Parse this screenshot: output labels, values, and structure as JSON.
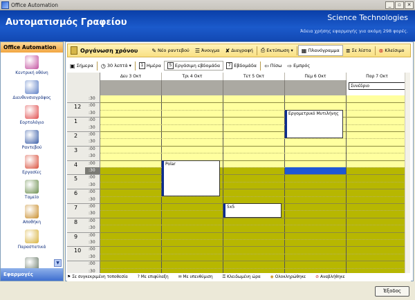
{
  "window": {
    "title": "Office Automation"
  },
  "header": {
    "app_title": "Αυτοματισμός Γραφείου",
    "company": "Science Technologies",
    "license": "Άδεια χρήσης εφαρμογής για ακόμη 298 φορές."
  },
  "sidebar": {
    "title": "Office Automation",
    "items": [
      {
        "label": "Κεντρική οθόνη",
        "icon": "home-people-icon",
        "color": "#c24f9e"
      },
      {
        "label": "Διευθυνσιογράφος",
        "icon": "contacts-icon",
        "color": "#5c7fc6"
      },
      {
        "label": "Εορτολόγιο",
        "icon": "calendar-icon",
        "color": "#e04c4c"
      },
      {
        "label": "Ραντεβού",
        "icon": "appointment-icon",
        "color": "#3a5ea8"
      },
      {
        "label": "Εργασίες",
        "icon": "tasks-icon",
        "color": "#d94e3a"
      },
      {
        "label": "Ταμείο",
        "icon": "cashbox-icon",
        "color": "#6b8e4e"
      },
      {
        "label": "Αποθήκη",
        "icon": "warehouse-icon",
        "color": "#c98d2a"
      },
      {
        "label": "Παραστατικά",
        "icon": "documents-icon",
        "color": "#d8b23b"
      },
      {
        "label": "",
        "icon": "recycle-bin-icon",
        "color": "#6a7b6a"
      }
    ],
    "footer": "Εφαρμογές"
  },
  "toolbar": {
    "section_title": "Οργάνωση χρόνου",
    "new_appointment": "Νέο ραντεβού",
    "open": "Άνοιγμα",
    "delete": "Διαγραφή",
    "print": "Εκτύπωση",
    "planner": "Πλανόγραμμα",
    "list": "Σε λίστα",
    "close": "Κλείσιμο"
  },
  "toolbar2": {
    "today": "Σήμερα",
    "interval": "30 λεπτά",
    "day": "Ημέρα",
    "work_week": "Εργάσιμη εβδομάδα",
    "week": "Εβδομάδα",
    "back": "Πίσω",
    "forward": "Εμπρός",
    "day_num": "1",
    "work_week_num": "5",
    "week_num": "7"
  },
  "calendar": {
    "days": [
      "Δευ 3 Οκτ",
      "Τρι 4 Οκτ",
      "Τετ 5 Οκτ",
      "Πεμ 6 Οκτ",
      "Παρ 7 Οκτ"
    ],
    "allday_event": "Συνέδριο",
    "hour_labels": [
      "12",
      "1",
      "2",
      "3",
      "4",
      "5",
      "6",
      "7",
      "8",
      "9",
      "10"
    ],
    "sub_labels": {
      "top": ":00",
      "half": ":30"
    },
    "appointments": [
      {
        "title": "Εργομετρικό Μυτιλήνης",
        "day": 3,
        "start": 12.5,
        "end": 14.5
      },
      {
        "title": "Polar",
        "day": 1,
        "start": 16.0,
        "end": 18.5
      },
      {
        "title": "5x5",
        "day": 2,
        "start": 19.0,
        "end": 20.0
      }
    ],
    "selected_block": {
      "day": 3,
      "start": 16.5,
      "end": 17.0
    }
  },
  "status": {
    "items": [
      {
        "label": "Σε συγκεκριμένη τοποθεσία",
        "icon": "location-icon"
      },
      {
        "label": "Με επιφύλαξη",
        "icon": "question-icon"
      },
      {
        "label": "Με υπενθύμιση",
        "icon": "reminder-icon"
      },
      {
        "label": "Κλειδωμένη ώρα",
        "icon": "lock-icon"
      },
      {
        "label": "Ολοκληρώθηκε",
        "icon": "done-icon"
      },
      {
        "label": "Αναβλήθηκε",
        "icon": "postponed-icon"
      }
    ]
  },
  "footer": {
    "exit": "Έξοδος"
  }
}
